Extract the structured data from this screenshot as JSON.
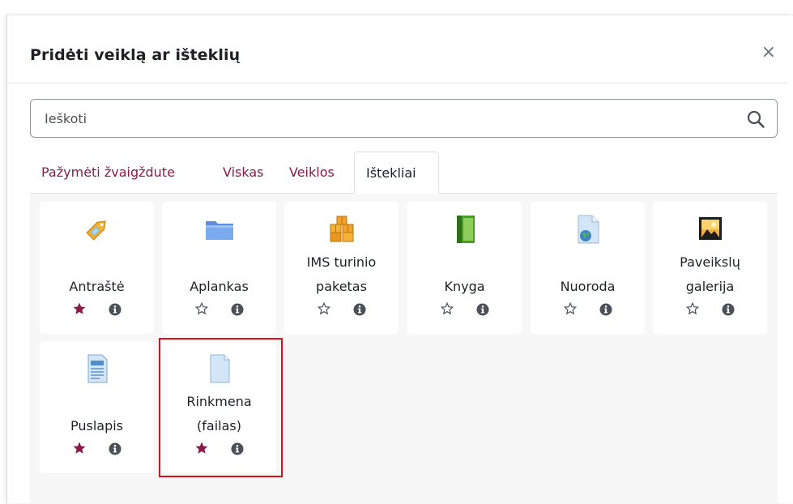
{
  "modal": {
    "title": "Pridėti veiklą ar išteklių",
    "close_label": "×"
  },
  "search": {
    "placeholder": "Ieškoti"
  },
  "tabs": [
    {
      "label": "Pažymėti žvaigždute",
      "active": false
    },
    {
      "label": "Viskas",
      "active": false
    },
    {
      "label": "Veiklos",
      "active": false
    },
    {
      "label": "Ištekliai",
      "active": true
    }
  ],
  "items": [
    {
      "label_lines": [
        "Antraštė"
      ],
      "starred": true,
      "icon": "tag-label-icon"
    },
    {
      "label_lines": [
        "Aplankas"
      ],
      "starred": false,
      "icon": "folder-icon"
    },
    {
      "label_lines": [
        "IMS turinio",
        "paketas"
      ],
      "starred": false,
      "icon": "package-boxes-icon"
    },
    {
      "label_lines": [
        "Knyga"
      ],
      "starred": false,
      "icon": "book-icon"
    },
    {
      "label_lines": [
        "Nuoroda"
      ],
      "starred": false,
      "icon": "url-globe-document-icon"
    },
    {
      "label_lines": [
        "Paveikslų",
        "galerija"
      ],
      "starred": false,
      "icon": "image-gallery-icon"
    },
    {
      "label_lines": [
        "Puslapis"
      ],
      "starred": true,
      "icon": "page-document-icon"
    },
    {
      "label_lines": [
        "Rinkmena",
        "(failas)"
      ],
      "starred": true,
      "icon": "file-document-icon"
    }
  ],
  "colors": {
    "accent": "#8c1a4b",
    "star_filled": "#8c1a4b",
    "highlight": "#e0101a",
    "panel_bg": "#f7f7f8"
  }
}
